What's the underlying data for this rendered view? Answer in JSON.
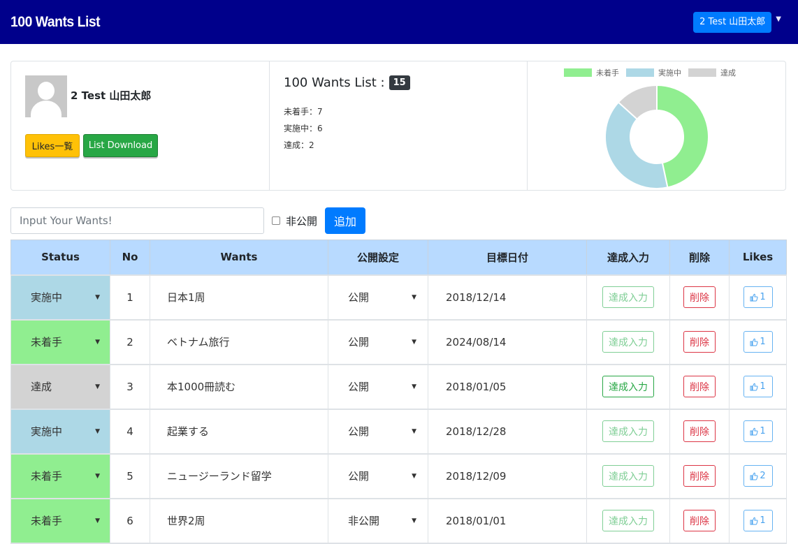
{
  "navbar": {
    "brand": "100 Wants List",
    "user": "2 Test 山田太郎"
  },
  "profile": {
    "name": "2 Test 山田太郎",
    "likes_button": "Likes一覧",
    "download_button": "List Download"
  },
  "summary": {
    "title": "100 Wants List :",
    "count": "15",
    "stats": [
      "未着手：7",
      "実施中：6",
      "達成：2"
    ]
  },
  "colors": {
    "not_started": "#90ee90",
    "in_progress": "#add8e6",
    "achieved": "#d3d3d3",
    "nav": "#00008b"
  },
  "chart_data": {
    "type": "pie",
    "variant": "doughnut",
    "labels": [
      "未着手",
      "実施中",
      "達成"
    ],
    "values": [
      7,
      6,
      2
    ],
    "colors": [
      "#90ee90",
      "#add8e6",
      "#d3d3d3"
    ],
    "legend": "top"
  },
  "form": {
    "placeholder": "Input Your Wants!",
    "private_label": "非公開",
    "add_button": "追加"
  },
  "table": {
    "headers": [
      "Status",
      "No",
      "Wants",
      "公開設定",
      "目標日付",
      "達成入力",
      "削除",
      "Likes"
    ],
    "rows": [
      {
        "status": "実施中",
        "no": "1",
        "want": "日本1周",
        "visibility": "公開",
        "date": "2018/12/14",
        "achieve": "達成入力",
        "delete": "削除",
        "likes": "1"
      },
      {
        "status": "未着手",
        "no": "2",
        "want": "ベトナム旅行",
        "visibility": "公開",
        "date": "2024/08/14",
        "achieve": "達成入力",
        "delete": "削除",
        "likes": "1"
      },
      {
        "status": "達成",
        "no": "3",
        "want": "本1000冊読む",
        "visibility": "公開",
        "date": "2018/01/05",
        "achieve": "達成入力",
        "delete": "削除",
        "likes": "1"
      },
      {
        "status": "実施中",
        "no": "4",
        "want": "起業する",
        "visibility": "公開",
        "date": "2018/12/28",
        "achieve": "達成入力",
        "delete": "削除",
        "likes": "1"
      },
      {
        "status": "未着手",
        "no": "5",
        "want": "ニュージーランド留学",
        "visibility": "公開",
        "date": "2018/12/09",
        "achieve": "達成入力",
        "delete": "削除",
        "likes": "2"
      },
      {
        "status": "未着手",
        "no": "6",
        "want": "世界2周",
        "visibility": "非公開",
        "date": "2018/01/01",
        "achieve": "達成入力",
        "delete": "削除",
        "likes": "1"
      }
    ]
  }
}
